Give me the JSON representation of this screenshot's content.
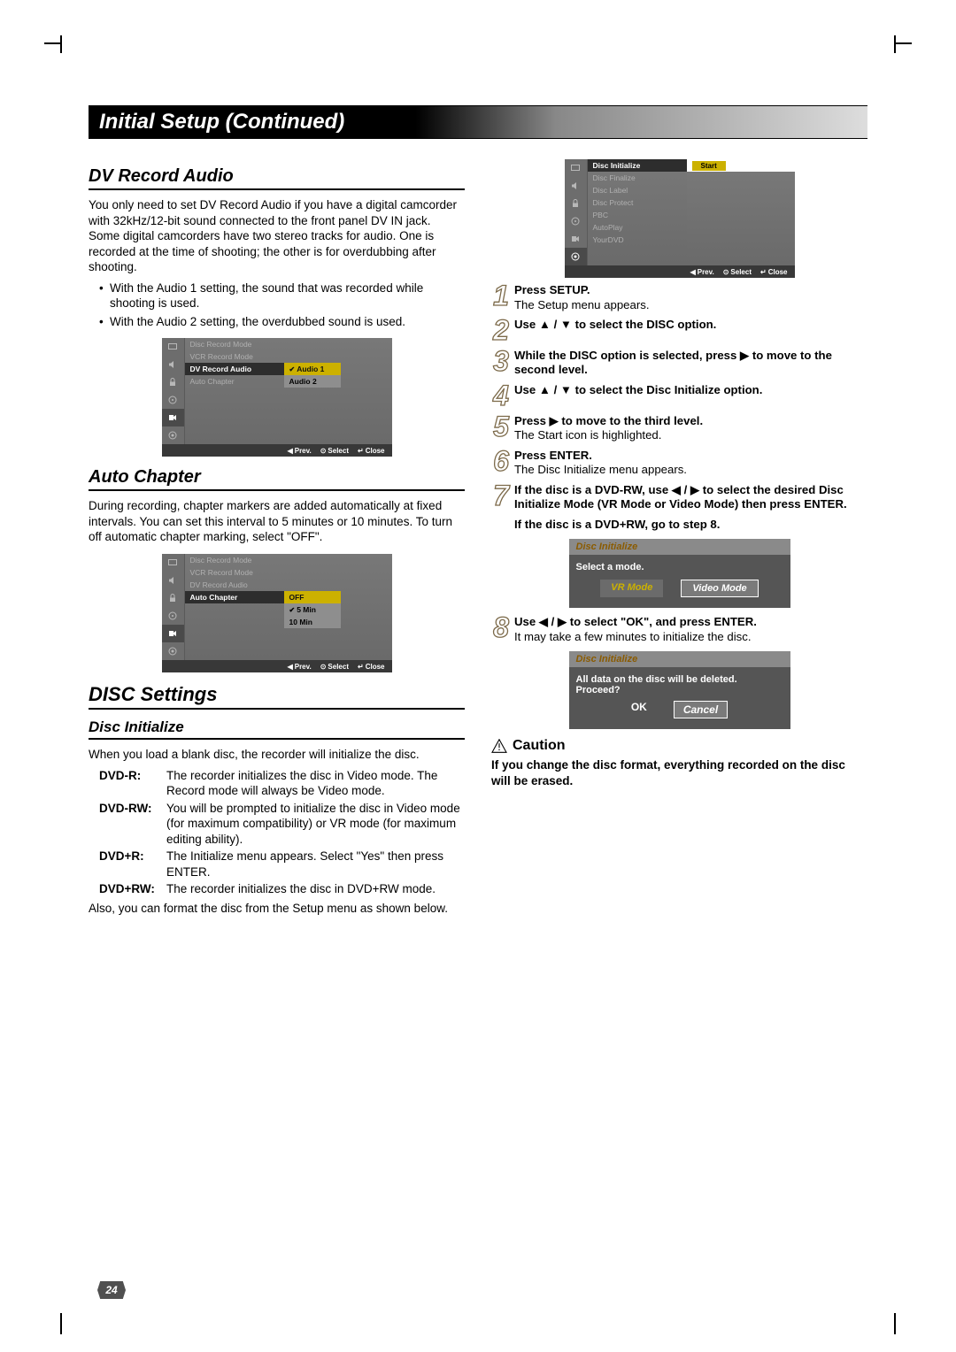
{
  "page_title": "Initial Setup (Continued)",
  "left": {
    "sec1_title": "DV Record Audio",
    "sec1_body": "You only need to set DV Record Audio if you have a digital camcorder with 32kHz/12-bit sound connected to the front panel DV IN jack. Some digital camcorders have two stereo tracks for audio. One is recorded at the time of shooting; the other is for overdubbing after shooting.",
    "sec1_b1": "With the Audio 1 setting, the sound that was recorded while shooting is used.",
    "sec1_b2": "With the Audio 2 setting, the overdubbed sound is used.",
    "osd1": {
      "items": [
        "Disc Record Mode",
        "VCR Record Mode",
        "DV Record Audio",
        "Auto Chapter"
      ],
      "opts": [
        "Audio 1",
        "Audio 2"
      ],
      "foot_prev": "Prev.",
      "foot_sel": "Select",
      "foot_close": "Close"
    },
    "sec2_title": "Auto Chapter",
    "sec2_body": "During recording, chapter markers are added automatically at fixed intervals. You can set this interval to 5 minutes or 10 minutes. To turn off automatic chapter marking, select \"OFF\".",
    "osd2": {
      "items": [
        "Disc Record Mode",
        "VCR Record Mode",
        "DV Record Audio",
        "Auto Chapter"
      ],
      "opts": [
        "OFF",
        "5 Min",
        "10 Min"
      ],
      "foot_prev": "Prev.",
      "foot_sel": "Select",
      "foot_close": "Close"
    },
    "sec3_title": "DISC Settings",
    "sec3_sub": "Disc Initialize",
    "sec3_body": "When you load a blank disc, the recorder will initialize the disc.",
    "dt": {
      "a_lbl": "DVD-R:",
      "a_val": "The recorder initializes the disc in Video mode. The Record mode will always be Video mode.",
      "b_lbl": "DVD-RW:",
      "b_val": "You will be prompted to initialize the disc in Video mode (for maximum compatibility) or VR mode (for maximum editing ability).",
      "c_lbl": "DVD+R:",
      "c_val": "The Initialize menu appears. Select \"Yes\" then press ENTER.",
      "d_lbl": "DVD+RW:",
      "d_val": "The recorder initializes the disc in DVD+RW mode."
    },
    "sec3_tail": "Also, you can format the disc from the Setup menu as shown below."
  },
  "right": {
    "osd3": {
      "items": [
        "Disc Initialize",
        "Disc Finalize",
        "Disc Label",
        "Disc Protect",
        "PBC",
        "AutoPlay",
        "YourDVD"
      ],
      "start": "Start",
      "foot_prev": "Prev.",
      "foot_sel": "Select",
      "foot_close": "Close"
    },
    "step1_b": "Press SETUP.",
    "step1_d": "The Setup menu appears.",
    "step2_b": "Use ▲ / ▼ to select the DISC option.",
    "step3_b": "While the DISC option is selected, press ▶ to move to the second level.",
    "step4_b": "Use ▲ / ▼ to select the Disc Initialize option.",
    "step5_b": "Press ▶ to move to the third level.",
    "step5_d": "The Start icon is highlighted.",
    "step6_b": "Press ENTER.",
    "step6_d": "The Disc Initialize menu appears.",
    "step7_b": "If the disc is a DVD-RW, use ◀ / ▶ to select the desired Disc Initialize Mode (VR Mode or Video Mode) then press ENTER.",
    "step7_extra": "If the disc is a DVD+RW, go to step 8.",
    "dlg1": {
      "title": "Disc Initialize",
      "prompt": "Select a mode.",
      "m1": "VR Mode",
      "m2": "Video Mode"
    },
    "step8_b": "Use ◀ / ▶ to select \"OK\", and press ENTER.",
    "step8_d": "It may take a few minutes to initialize the disc.",
    "dlg2": {
      "title": "Disc Initialize",
      "prompt": "All data on the disc will be deleted. Proceed?",
      "ok": "OK",
      "cancel": "Cancel"
    },
    "caution_label": "Caution",
    "caution_text": "If you change the disc format, everything recorded on the disc will be erased."
  },
  "page_number": "24"
}
